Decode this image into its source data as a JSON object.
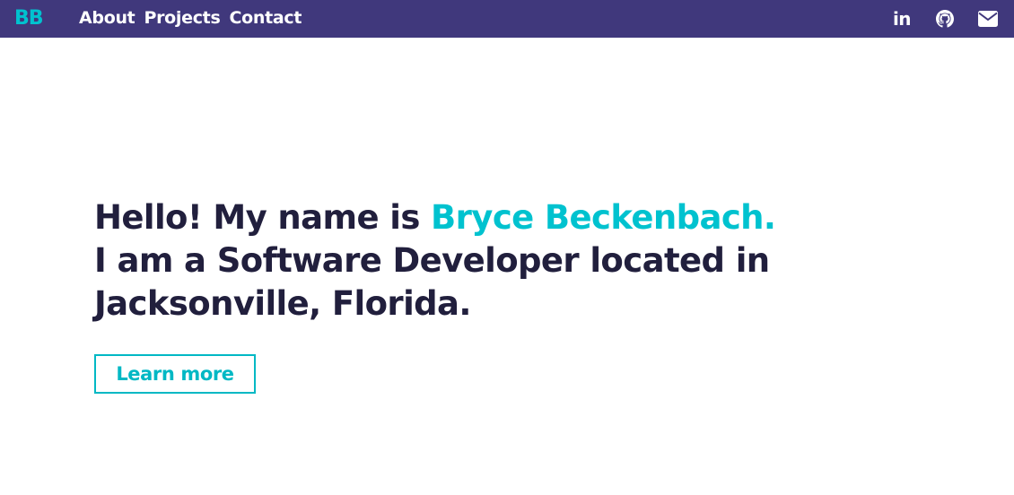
{
  "nav": {
    "logo": "BB",
    "links": [
      {
        "label": "About"
      },
      {
        "label": "Projects"
      },
      {
        "label": "Contact"
      }
    ],
    "icons": [
      "linkedin-icon",
      "github-icon",
      "mail-icon"
    ],
    "linkedin_glyph": "in"
  },
  "hero": {
    "greeting_prefix": "Hello! My name is ",
    "name": "Bryce Beckenbach.",
    "line2": "I am a Software Developer located in",
    "line3": "Jacksonville, Florida."
  },
  "cta": {
    "label": "Learn more"
  },
  "colors": {
    "navbar": "#40387c",
    "accent": "#00c2cf",
    "text": "#211f3d",
    "background": "#ffffff"
  }
}
